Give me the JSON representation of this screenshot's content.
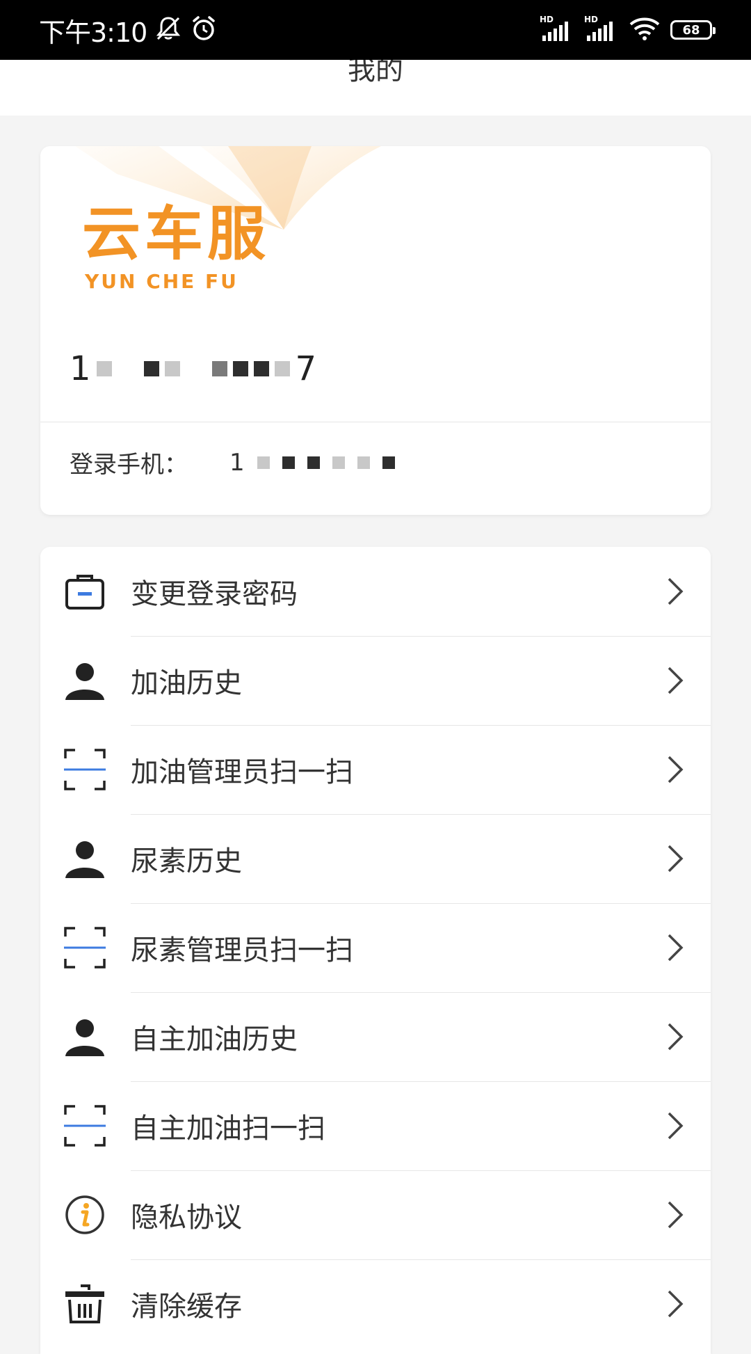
{
  "status_bar": {
    "time": "下午3:10",
    "network_label_1": "HD",
    "network_label_2": "HD",
    "battery": "68"
  },
  "header": {
    "title": "我的"
  },
  "profile": {
    "logo_cn": "云车服",
    "logo_en": "YUN CHE FU",
    "account_prefix": "1",
    "account_suffix": "7",
    "login_phone_label": "登录手机：",
    "login_phone_prefix": "1"
  },
  "menu": [
    {
      "label": "变更登录密码",
      "icon": "lock-icon"
    },
    {
      "label": "加油历史",
      "icon": "user-icon"
    },
    {
      "label": "加油管理员扫一扫",
      "icon": "scan-icon"
    },
    {
      "label": "尿素历史",
      "icon": "user-icon"
    },
    {
      "label": "尿素管理员扫一扫",
      "icon": "scan-icon"
    },
    {
      "label": "自主加油历史",
      "icon": "user-icon"
    },
    {
      "label": "自主加油扫一扫",
      "icon": "scan-icon"
    },
    {
      "label": "隐私协议",
      "icon": "info-icon"
    },
    {
      "label": "清除缓存",
      "icon": "trash-icon"
    }
  ],
  "colors": {
    "brand_orange": "#f29325",
    "scan_blue": "#3d7be0",
    "info_orange": "#f5a623"
  }
}
